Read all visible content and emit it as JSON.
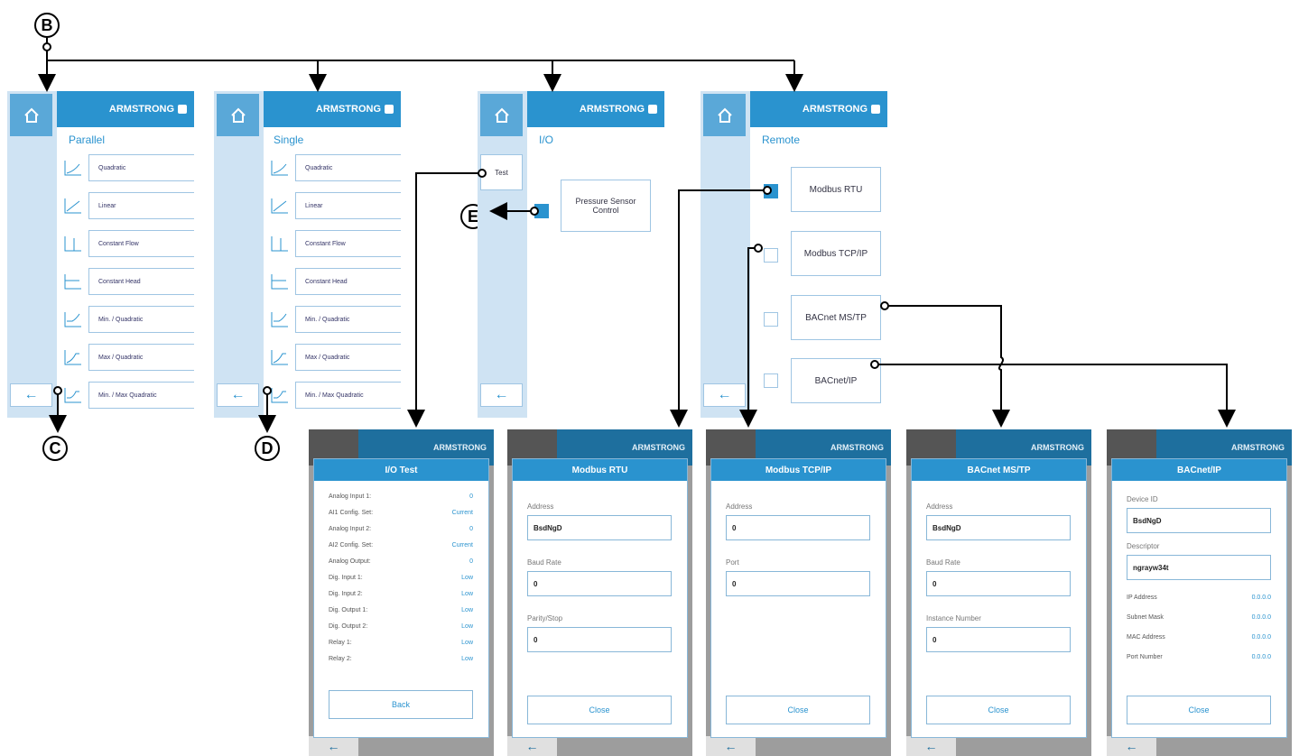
{
  "callouts": {
    "b": "B",
    "c": "C",
    "d": "D",
    "e": "E"
  },
  "brand": "ARMSTRONG",
  "icons": {
    "home": "home-icon",
    "back": "back-arrow-icon"
  },
  "back_glyph": "←",
  "colors": {
    "accent": "#2a93cf",
    "rail": "#cfe3f3",
    "header": "#2a93cf"
  },
  "parallel": {
    "title": "Parallel",
    "modes": [
      "Quadratic",
      "Linear",
      "Constant Flow",
      "Constant Head",
      "Min. / Quadratic",
      "Max / Quadratic",
      "Min. / Max Quadratic"
    ]
  },
  "single": {
    "title": "Single",
    "modes": [
      "Quadratic",
      "Linear",
      "Constant Flow",
      "Constant Head",
      "Min. / Quadratic",
      "Max / Quadratic",
      "Min. / Max Quadratic"
    ]
  },
  "io": {
    "title": "I/O",
    "test_label": "Test",
    "sensor_label": "Pressure Sensor Control"
  },
  "remote": {
    "title": "Remote",
    "protocols": [
      "Modbus RTU",
      "Modbus TCP/IP",
      "BACnet MS/TP",
      "BACnet/IP"
    ]
  },
  "io_test": {
    "title": "I/O Test",
    "rows": [
      {
        "label": "Analog Input 1:",
        "value": "0"
      },
      {
        "label": "AI1 Config. Set:",
        "value": "Current"
      },
      {
        "label": "Analog Input 2:",
        "value": "0"
      },
      {
        "label": "AI2 Config. Set:",
        "value": "Current"
      },
      {
        "label": "Analog Output:",
        "value": "0"
      },
      {
        "label": "Dig. Input 1:",
        "value": "Low"
      },
      {
        "label": "Dig. Input 2:",
        "value": "Low"
      },
      {
        "label": "Dig. Output 1:",
        "value": "Low"
      },
      {
        "label": "Dig. Output 2:",
        "value": "Low"
      },
      {
        "label": "Relay 1:",
        "value": "Low"
      },
      {
        "label": "Relay 2:",
        "value": "Low"
      }
    ],
    "button": "Back"
  },
  "modbus_rtu": {
    "title": "Modbus RTU",
    "fields": [
      {
        "label": "Address",
        "value": "BsdNgD"
      },
      {
        "label": "Baud Rate",
        "value": "0"
      },
      {
        "label": "Parity/Stop",
        "value": "0"
      }
    ],
    "button": "Close"
  },
  "modbus_tcp": {
    "title": "Modbus TCP/IP",
    "fields": [
      {
        "label": "Address",
        "value": "0"
      },
      {
        "label": "Port",
        "value": "0"
      }
    ],
    "button": "Close"
  },
  "bacnet_mstp": {
    "title": "BACnet MS/TP",
    "fields": [
      {
        "label": "Address",
        "value": "BsdNgD"
      },
      {
        "label": "Baud Rate",
        "value": "0"
      },
      {
        "label": "Instance Number",
        "value": "0"
      }
    ],
    "button": "Close"
  },
  "bacnet_ip": {
    "title": "BACnet/IP",
    "fields": [
      {
        "label": "Device ID",
        "value": "BsdNgD"
      },
      {
        "label": "Descriptor",
        "value": "ngrayw34t"
      }
    ],
    "info": [
      {
        "label": "IP Address",
        "value": "0.0.0.0"
      },
      {
        "label": "Subnet Mask",
        "value": "0.0.0.0"
      },
      {
        "label": "MAC Address",
        "value": "0.0.0.0"
      },
      {
        "label": "Port Number",
        "value": "0.0.0.0"
      }
    ],
    "button": "Close"
  }
}
